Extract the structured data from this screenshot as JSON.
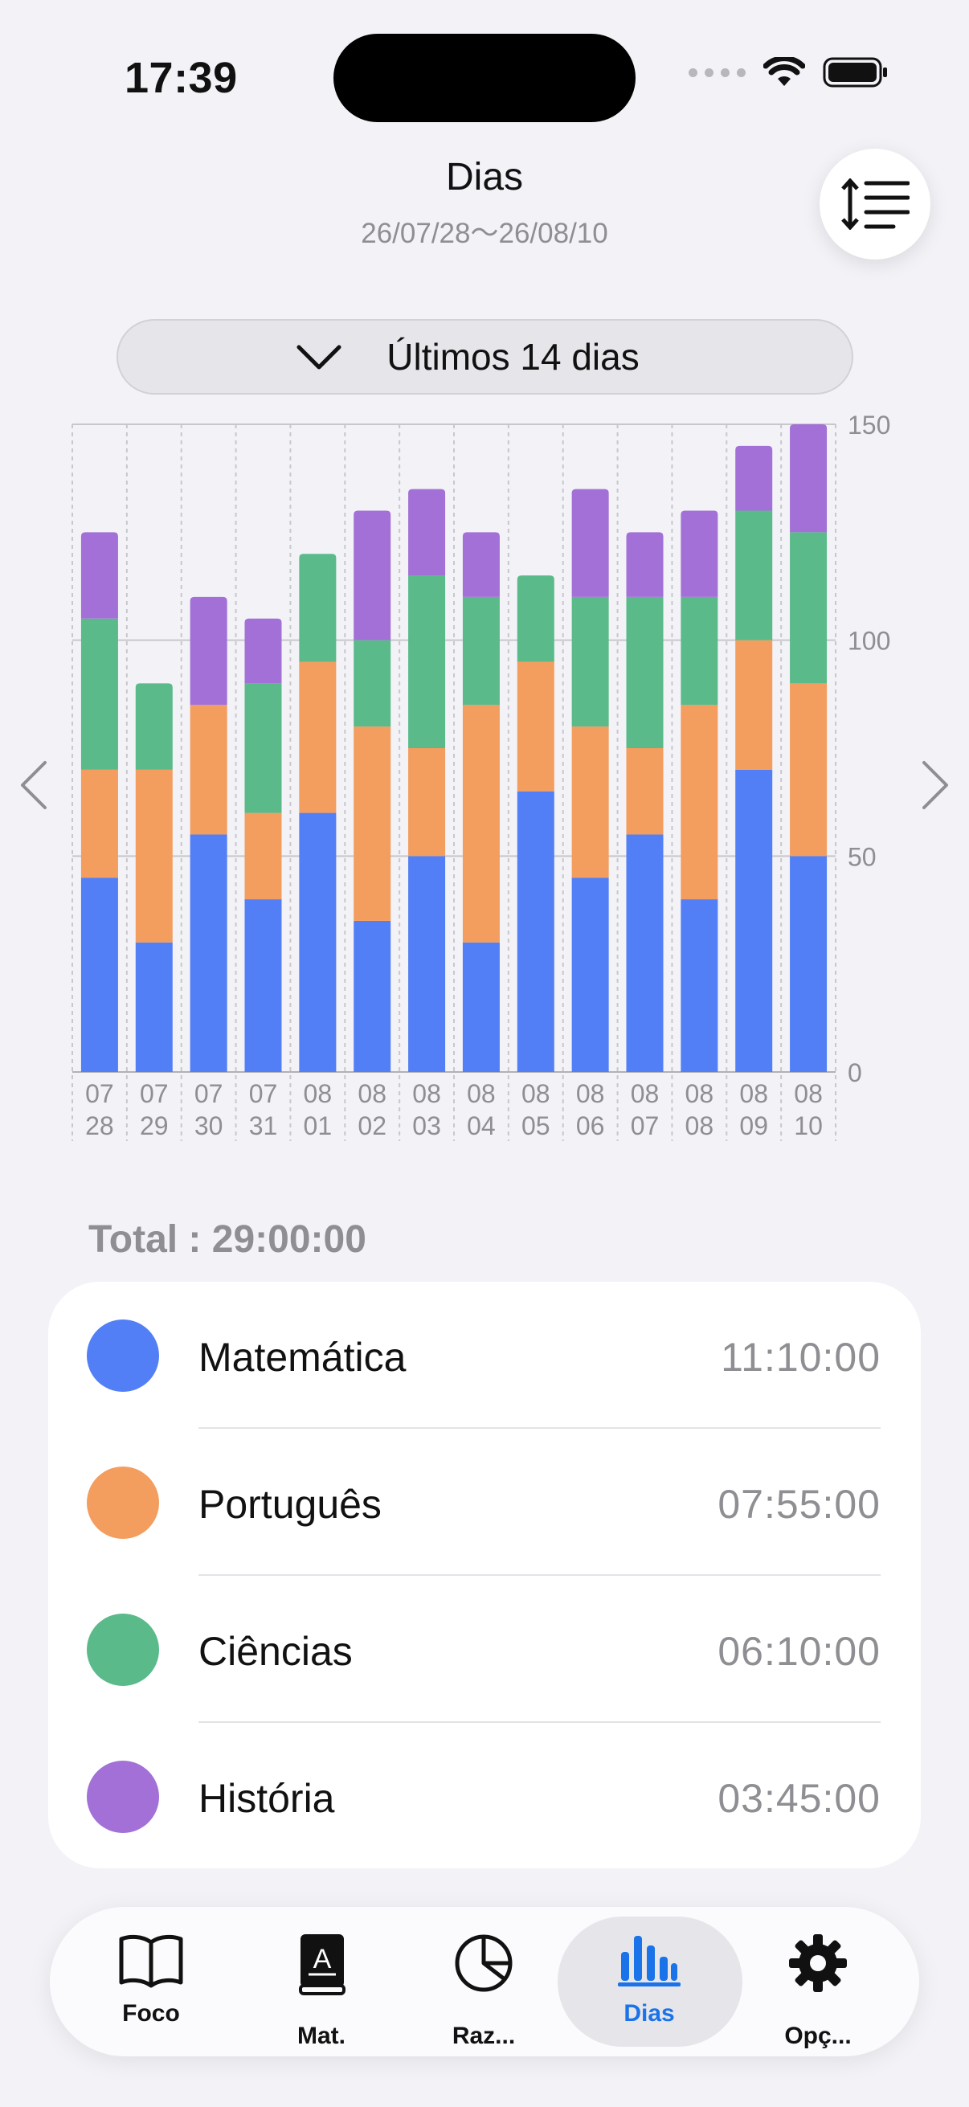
{
  "status_bar": {
    "time": "17:39"
  },
  "header": {
    "title": "Dias",
    "range": "26/07/28～26/08/10"
  },
  "period": {
    "label": "Últimos 14 dias"
  },
  "colors": {
    "matematica": "#527ff6",
    "portugues": "#f39d5e",
    "ciencias": "#5aba8a",
    "historia": "#a270d6",
    "accent": "#1a73e8"
  },
  "chart_data": {
    "type": "bar",
    "stacked": true,
    "categories": [
      "07\n28",
      "07\n29",
      "07\n30",
      "07\n31",
      "08\n01",
      "08\n02",
      "08\n03",
      "08\n04",
      "08\n05",
      "08\n06",
      "08\n07",
      "08\n08",
      "08\n09",
      "08\n10"
    ],
    "series": [
      {
        "name": "Matemática",
        "color": "#527ff6",
        "values": [
          45,
          30,
          55,
          40,
          60,
          35,
          50,
          30,
          65,
          45,
          55,
          40,
          70,
          50
        ]
      },
      {
        "name": "Português",
        "color": "#f39d5e",
        "values": [
          25,
          40,
          30,
          20,
          35,
          45,
          25,
          55,
          30,
          35,
          20,
          45,
          30,
          40
        ]
      },
      {
        "name": "Ciências",
        "color": "#5aba8a",
        "values": [
          35,
          20,
          0,
          30,
          25,
          20,
          40,
          25,
          20,
          30,
          35,
          25,
          30,
          35
        ]
      },
      {
        "name": "História",
        "color": "#a270d6",
        "values": [
          20,
          0,
          25,
          15,
          0,
          30,
          20,
          15,
          0,
          25,
          15,
          20,
          15,
          25
        ]
      }
    ],
    "yticks": [
      0,
      50,
      100,
      150
    ],
    "ylim": [
      0,
      150
    ],
    "grid": true
  },
  "total": {
    "label": "Total : 29:00:00"
  },
  "subjects": [
    {
      "name": "Matemática",
      "time": "11:10:00",
      "color": "#527ff6"
    },
    {
      "name": "Português",
      "time": "07:55:00",
      "color": "#f39d5e"
    },
    {
      "name": "Ciências",
      "time": "06:10:00",
      "color": "#5aba8a"
    },
    {
      "name": "História",
      "time": "03:45:00",
      "color": "#a270d6"
    }
  ],
  "tabs": [
    {
      "label": "Foco",
      "icon": "book-icon"
    },
    {
      "label": "Mat.",
      "icon": "dictionary-icon"
    },
    {
      "label": "Raz...",
      "icon": "pie-chart-icon"
    },
    {
      "label": "Dias",
      "icon": "bar-chart-icon",
      "active": true
    },
    {
      "label": "Opç...",
      "icon": "gear-icon"
    }
  ]
}
